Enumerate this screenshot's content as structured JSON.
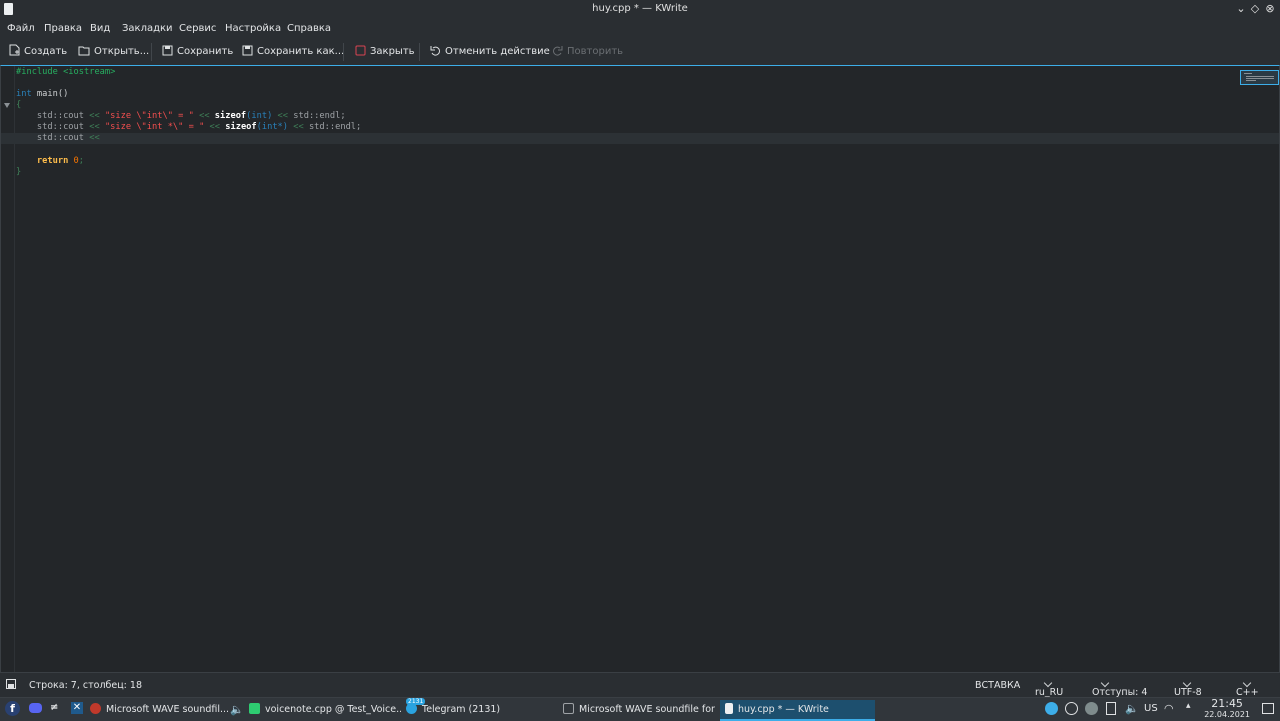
{
  "window": {
    "title": "huy.cpp * — KWrite"
  },
  "menu": [
    "Файл",
    "Правка",
    "Вид",
    "Закладки",
    "Сервис",
    "Настройка",
    "Справка"
  ],
  "toolbar": {
    "new": "Создать",
    "open": "Открыть...",
    "save": "Сохранить",
    "save_as": "Сохранить как...",
    "close": "Закрыть",
    "undo": "Отменить действие",
    "redo": "Повторить"
  },
  "code": {
    "include_line": "#include <iostream>",
    "int_kw": "int",
    "main_fn": " main()",
    "open_brace": "{",
    "l5_ns": "    std::cout ",
    "l5_op1": "<< ",
    "l5_str": "\"size \\\"int\\\" = \"",
    "l5_op2": " << ",
    "l5_kw": "sizeof",
    "l5_arg": "(int)",
    "l5_op3": " << ",
    "l5_end": "std::endl;",
    "l6_ns": "    std::cout ",
    "l6_op1": "<< ",
    "l6_str": "\"size \\\"int *\\\" = \"",
    "l6_op2": " << ",
    "l6_kw": "sizeof",
    "l6_arg": "(int*)",
    "l6_op3": " << ",
    "l6_end": "std::endl;",
    "l7_ns": "    std::cout ",
    "l7_op": "<<",
    "ret_kw": "    return",
    "ret_val": " 0",
    "ret_semi": ";",
    "close_brace": "}"
  },
  "status": {
    "position": "Строка: 7, столбец: 18",
    "mode": "ВСТАВКА",
    "dictionary": "ru_RU",
    "indent": "Отступы: 4",
    "encoding": "UTF-8",
    "syntax": "C++"
  },
  "taskbar": {
    "tasks": [
      "Microsoft WAVE soundfil...",
      "voicenote.cpp @ Test_Voice...",
      "Telegram (2131)",
      "Microsoft WAVE soundfile for...",
      "huy.cpp * — KWrite"
    ],
    "telegram_badge": "2131",
    "keyboard_layout": "US",
    "time": "21:45",
    "date": "22.04.2021"
  }
}
